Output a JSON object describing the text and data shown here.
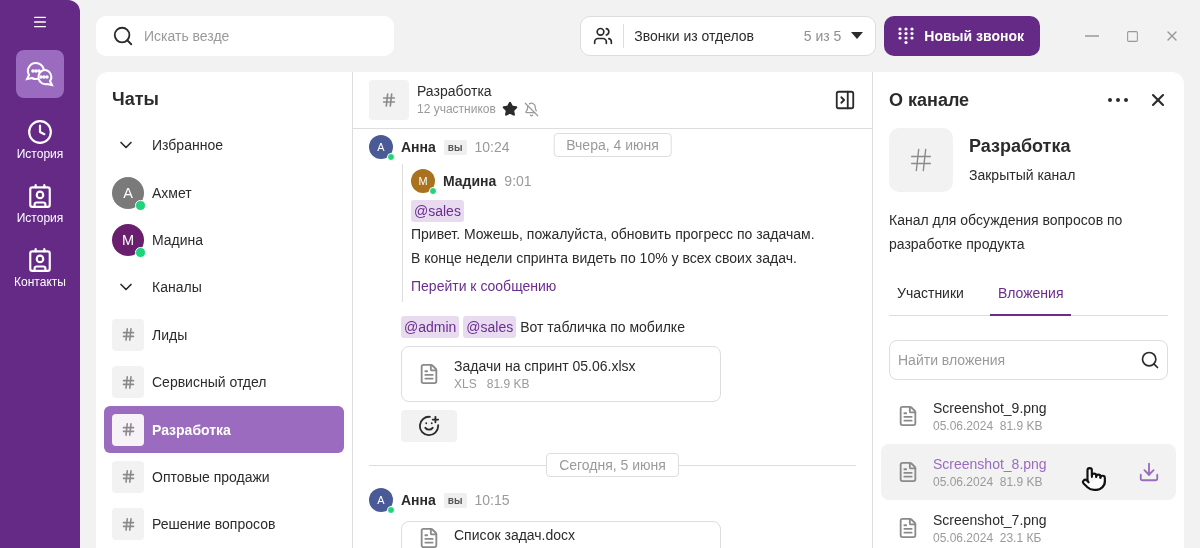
{
  "rail": {
    "items": [
      {
        "kind": "chats",
        "selected": true
      },
      {
        "kind": "clock",
        "label": "История",
        "selected": false
      },
      {
        "kind": "contact",
        "label": "История",
        "selected": false
      },
      {
        "kind": "contact",
        "label": "Контакты",
        "selected": false
      }
    ]
  },
  "search": {
    "placeholder": "Искать везде"
  },
  "call_filter": {
    "label": "Звонки из отделов",
    "count": "5 из 5"
  },
  "new_call_button": "Новый звонок",
  "chat_list": {
    "title": "Чаты",
    "groups": [
      {
        "title": "Избранное",
        "expanded": true,
        "items": [
          {
            "kind": "person",
            "initial": "А",
            "name": "Ахмет",
            "color": "#7a7a7a",
            "online": true,
            "selected": false
          },
          {
            "kind": "person",
            "initial": "М",
            "name": "Мадина",
            "color": "#6a1f6e",
            "online": true,
            "selected": false
          }
        ]
      },
      {
        "title": "Каналы",
        "expanded": true,
        "items": [
          {
            "kind": "channel",
            "name": "Лиды",
            "selected": false
          },
          {
            "kind": "channel",
            "name": "Сервисный отдел",
            "selected": false
          },
          {
            "kind": "channel",
            "name": "Разработка",
            "selected": true
          },
          {
            "kind": "channel",
            "name": "Оптовые продажи",
            "selected": false
          },
          {
            "kind": "channel",
            "name": "Решение вопросов",
            "selected": false
          }
        ]
      }
    ]
  },
  "chat": {
    "title": "Разработка",
    "subtitle": "12 участников",
    "starred": true,
    "muted": true,
    "sticky_date": "Вчера, 4 июня",
    "feed": [
      {
        "kind": "message",
        "author": "Анна",
        "initial": "А",
        "color": "#4a5a96",
        "online": true,
        "badge": "вы",
        "time": "10:24",
        "quote": {
          "author": "Мадина",
          "initial": "М",
          "color": "#a8721f",
          "online": true,
          "time": "9:01",
          "mention": "@sales",
          "lines": [
            "Привет. Можешь, пожалуйста, обновить прогресс по задачам.",
            "В конце недели спринта видеть по 10% у всех своих задач."
          ],
          "link": "Перейти к сообщению"
        },
        "mentions": [
          "@admin",
          "@sales"
        ],
        "text": "Вот табличка по мобилке",
        "attachment": {
          "name": "Задачи на спринт 05.06.xlsx",
          "type": "XLS",
          "size": "81.9 KB"
        },
        "reaction_button": true
      },
      {
        "kind": "date",
        "label": "Сегодня, 5 июня"
      },
      {
        "kind": "message",
        "author": "Анна",
        "initial": "А",
        "color": "#4a5a96",
        "online": true,
        "badge": "вы",
        "time": "10:15",
        "attachment": {
          "name": "Список задач.docx"
        }
      }
    ]
  },
  "info": {
    "title": "О канале",
    "channel_name": "Разработка",
    "channel_type": "Закрытый канал",
    "description": "Канал для обсуждения вопросов по разработке продукта",
    "tabs": [
      {
        "label": "Участники",
        "selected": false
      },
      {
        "label": "Вложения",
        "selected": true
      }
    ],
    "search": {
      "placeholder": "Найти вложения"
    },
    "files": [
      {
        "name": "Screenshot_9.png",
        "date": "05.06.2024",
        "size": "81.9 KB",
        "hovered": false
      },
      {
        "name": "Screenshot_8.png",
        "date": "05.06.2024",
        "size": "81.9 KB",
        "hovered": true
      },
      {
        "name": "Screenshot_7.png",
        "date": "05.06.2024",
        "size": "23.1 КБ",
        "hovered": false
      }
    ]
  }
}
